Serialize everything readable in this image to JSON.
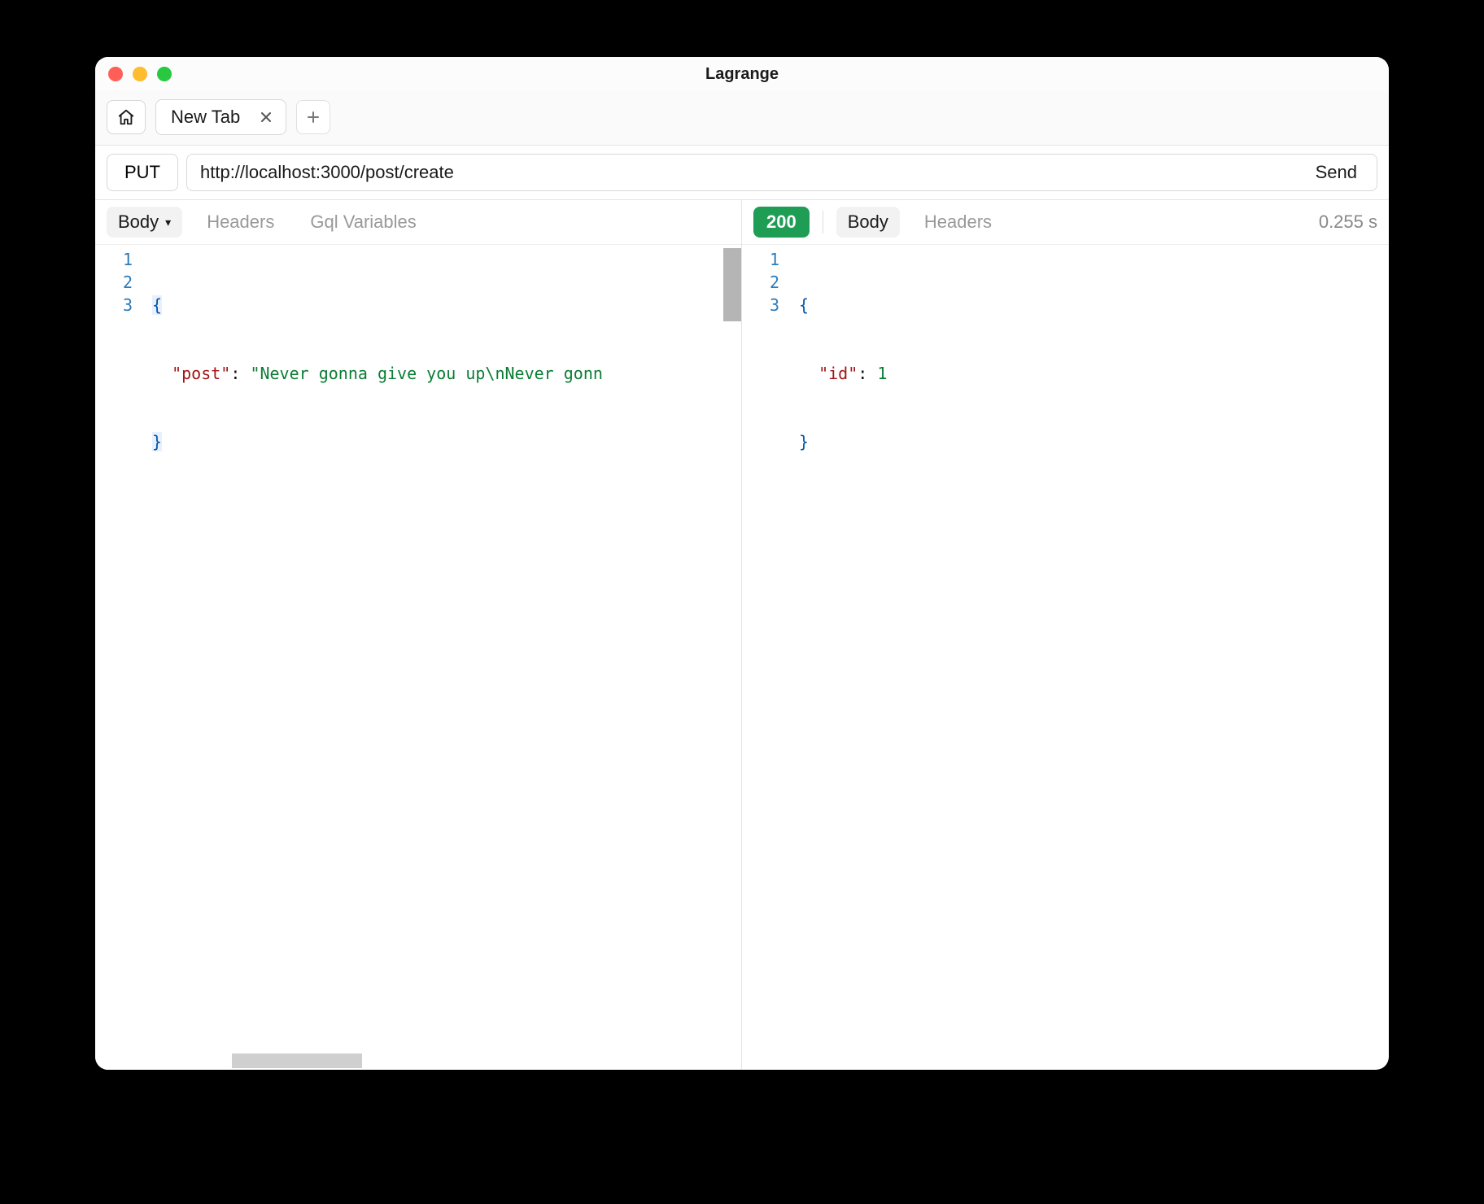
{
  "window": {
    "title": "Lagrange"
  },
  "tabs": {
    "active_label": "New Tab"
  },
  "request": {
    "method": "PUT",
    "url": "http://localhost:3000/post/create",
    "send_label": "Send"
  },
  "request_pane": {
    "tabs": {
      "body": "Body",
      "headers": "Headers",
      "gql": "Gql Variables"
    },
    "body_lines": [
      {
        "n": "1",
        "brace": "{"
      },
      {
        "n": "2",
        "indent": "  ",
        "key": "\"post\"",
        "colon": ": ",
        "value": "\"Never gonna give you up\\nNever gonn"
      },
      {
        "n": "3",
        "brace": "}"
      }
    ]
  },
  "response_pane": {
    "status": "200",
    "tabs": {
      "body": "Body",
      "headers": "Headers"
    },
    "timing": "0.255 s",
    "body_lines": [
      {
        "n": "1",
        "brace": "{"
      },
      {
        "n": "2",
        "indent": "  ",
        "key": "\"id\"",
        "colon": ": ",
        "value": "1"
      },
      {
        "n": "3",
        "brace": "}"
      }
    ]
  }
}
